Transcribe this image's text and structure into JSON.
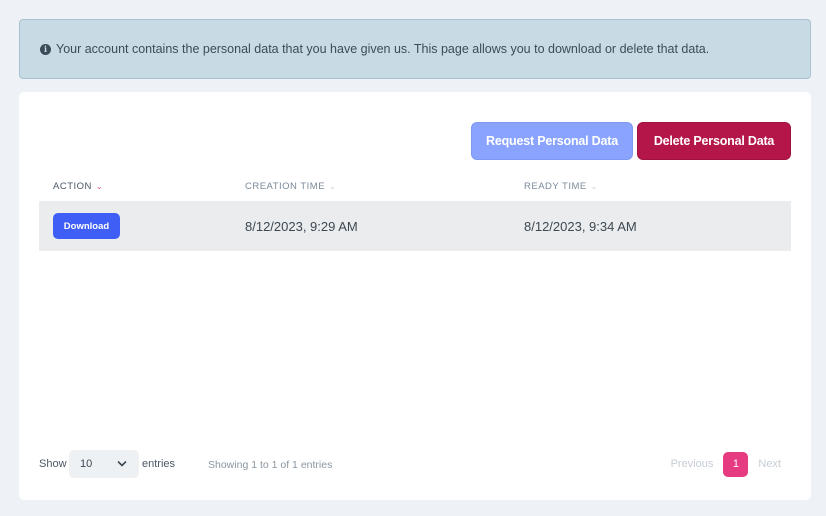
{
  "alert": {
    "icon": "info-circle-icon",
    "text": "Your account contains the personal data that you have given us. This page allows you to download or delete that data."
  },
  "actions": {
    "request_label": "Request Personal Data",
    "delete_label": "Delete Personal Data"
  },
  "table": {
    "columns": [
      {
        "label": "ACTION",
        "sort": "descending"
      },
      {
        "label": "CREATION TIME",
        "sort": "none"
      },
      {
        "label": "READY TIME",
        "sort": "none"
      }
    ],
    "rows": [
      {
        "action_label": "Download",
        "creation_time": "8/12/2023, 9:29 AM",
        "ready_time": "8/12/2023, 9:34 AM"
      }
    ]
  },
  "footer": {
    "show_label": "Show",
    "page_size": "10",
    "entries_label": "entries",
    "info": "Showing 1 to 1 of 1 entries",
    "previous_label": "Previous",
    "current_page": "1",
    "next_label": "Next"
  },
  "colors": {
    "primary": "#3e5ef5",
    "danger": "#b5164a",
    "active_page": "#e63b80"
  }
}
